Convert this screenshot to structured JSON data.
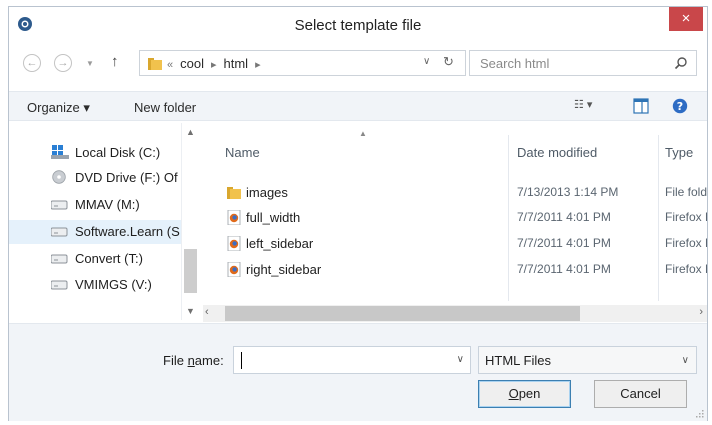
{
  "window": {
    "title": "Select template file",
    "close_glyph": "×"
  },
  "nav": {
    "back_glyph": "←",
    "forward_glyph": "→",
    "recent_glyph": "▼",
    "up_glyph": "↑",
    "breadcrumbs": [
      {
        "label": "«"
      },
      {
        "label": "cool"
      },
      {
        "label": "▸"
      },
      {
        "label": "html"
      },
      {
        "label": "▸"
      }
    ],
    "address_dropdown_glyph": "∨",
    "refresh_glyph": "↻",
    "search": {
      "placeholder": "Search html",
      "value": ""
    }
  },
  "toolbar": {
    "organize_label": "Organize ▾",
    "new_folder_label": "New folder",
    "view_glyph": "☷ ▾"
  },
  "sidebar": {
    "items": [
      {
        "label": "Local Disk (C:)",
        "icon": "local-disk-icon"
      },
      {
        "label": "DVD Drive (F:) Of",
        "icon": "dvd-drive-icon"
      },
      {
        "label": "MMAV (M:)",
        "icon": "network-drive-icon"
      },
      {
        "label": "Software.Learn (S",
        "icon": "network-drive-icon"
      },
      {
        "label": "Convert (T:)",
        "icon": "network-drive-icon"
      },
      {
        "label": "VMIMGS (V:)",
        "icon": "network-drive-icon"
      }
    ]
  },
  "filelist": {
    "columns": {
      "name": "Name",
      "date": "Date modified",
      "type": "Type"
    },
    "rows": [
      {
        "name": "images",
        "date": "7/13/2013 1:14 PM",
        "type": "File folder",
        "icon": "folder-icon"
      },
      {
        "name": "full_width",
        "date": "7/7/2011 4:01 PM",
        "type": "Firefox HT",
        "icon": "html-file-icon"
      },
      {
        "name": "left_sidebar",
        "date": "7/7/2011 4:01 PM",
        "type": "Firefox HT",
        "icon": "html-file-icon"
      },
      {
        "name": "right_sidebar",
        "date": "7/7/2011 4:01 PM",
        "type": "Firefox HT",
        "icon": "html-file-icon"
      }
    ]
  },
  "footer": {
    "filename_label_pre": "File ",
    "filename_label_key": "n",
    "filename_label_post": "ame:",
    "filename_value": "",
    "filetype_value": "HTML Files",
    "open_key": "O",
    "open_rest": "pen",
    "cancel_label": "Cancel"
  },
  "colors": {
    "close_button": "#c9474a",
    "selection": "#e5f1fb",
    "toolbar_bg": "#f1f4f8",
    "accent": "#3c7fb1"
  }
}
